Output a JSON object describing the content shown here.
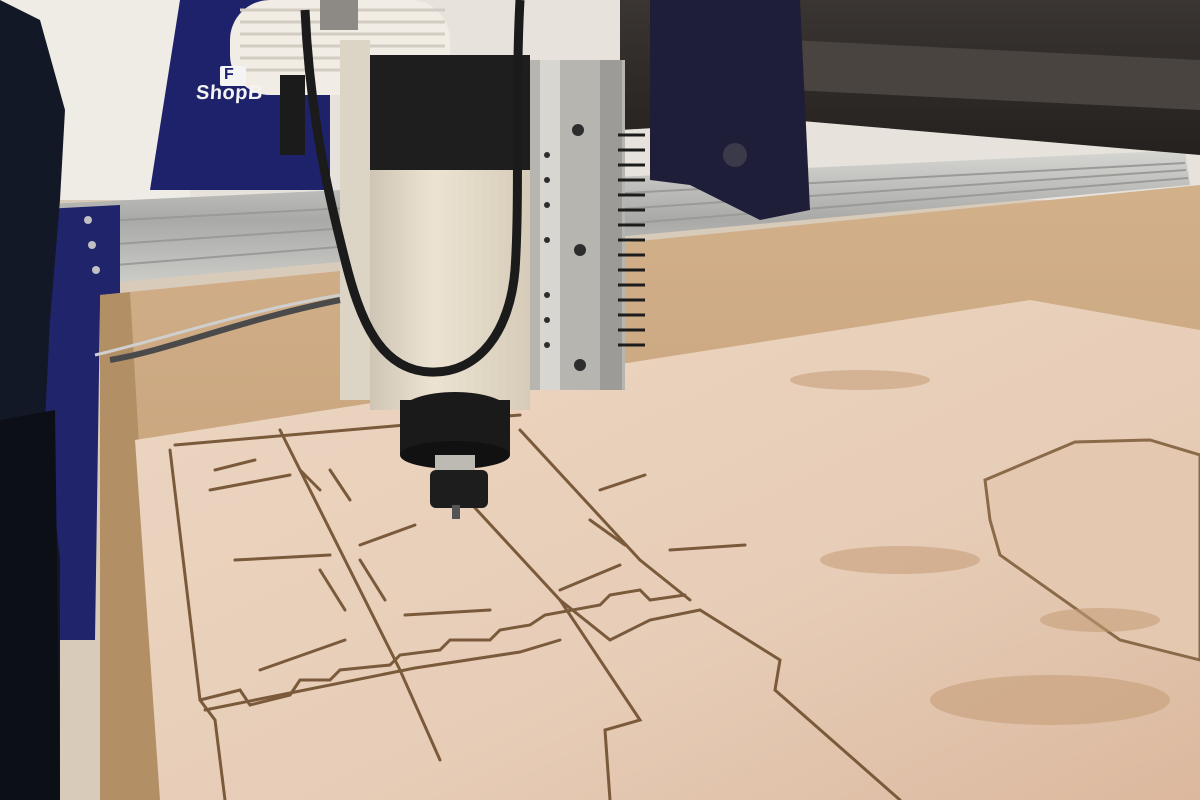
{
  "photo": {
    "subject": "cnc-router-spindle-over-plywood-sheet",
    "brand_sign": {
      "badge": "F",
      "text": "ShopB"
    },
    "colors": {
      "wood_light": "#e9d2bd",
      "wood_table": "#c8a47a",
      "rail_silver": "#b9bab8",
      "gantry_navy": "#1c1f63",
      "gantry_dark": "#2e2a28",
      "spindle_cream": "#e6dccb",
      "groove": "#7a5a3a"
    }
  }
}
